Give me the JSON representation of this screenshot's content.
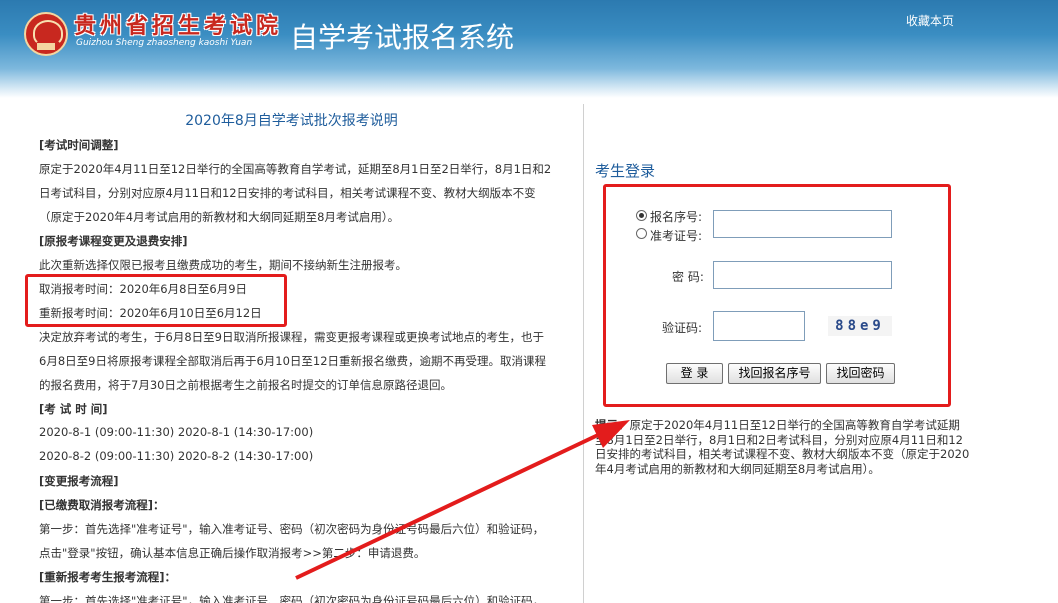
{
  "header": {
    "logo_cn": "贵州省招生考试院",
    "logo_pinyin": "Guizhou Sheng zhaosheng kaoshi Yuan",
    "system_title": "自学考试报名系统",
    "favorite_link": "收藏本页"
  },
  "notice": {
    "title": "2020年8月自学考试批次报考说明",
    "lines": [
      "[考试时间调整]",
      "原定于2020年4月11日至12日举行的全国高等教育自学考试，延期至8月1日至2日举行，8月1日和2",
      "日考试科目，分别对应原4月11日和12日安排的考试科目，相关考试课程不变、教材大纲版本不变",
      "（原定于2020年4月考试启用的新教材和大纲同延期至8月考试启用）。",
      "[原报考课程变更及退费安排]",
      "此次重新选择仅限已报考且缴费成功的考生，期间不接纳新生注册报考。",
      "取消报考时间：2020年6月8日至6月9日",
      "重新报考时间：2020年6月10日至6月12日",
      "决定放弃考试的考生，于6月8日至9日取消所报课程，需变更报考课程或更换考试地点的考生，也于",
      "6月8日至9日将原报考课程全部取消后再于6月10日至12日重新报名缴费，逾期不再受理。取消课程",
      "的报名费用，将于7月30日之前根据考生之前报名时提交的订单信息原路径退回。",
      "[考 试 时 间]",
      "2020-8-1 (09:00-11:30) 2020-8-1 (14:30-17:00)",
      "2020-8-2 (09:00-11:30) 2020-8-2 (14:30-17:00)",
      "[变更报考流程]",
      "[已缴费取消报考流程]：",
      "第一步：首先选择\"准考证号\"，输入准考证号、密码（初次密码为身份证号码最后六位）和验证码，",
      "点击\"登录\"按钮，确认基本信息正确后操作取消报考>>第二步：申请退费。",
      "[重新报考考生报考流程]：",
      "第一步：首先选择\"准考证号\"，输入准考证号、密码（初次密码为身份证号码最后六位）和验证码，"
    ]
  },
  "login": {
    "title": "考生登录",
    "radio_registration": "报名序号:",
    "radio_admission": "准考证号:",
    "password_label": "密  码:",
    "captcha_label": "验证码:",
    "captcha_text": "88e9",
    "login_button": "登  录",
    "find_reg_button": "找回报名序号",
    "find_pwd_button": "找回密码"
  },
  "tip": {
    "label": "提示：",
    "text": "原定于2020年4月11日至12日举行的全国高等教育自学考试延期至8月1日至2日举行，8月1日和2日考试科目，分别对应原4月11日和12日安排的考试科目，相关考试课程不变、教材大纲版本不变（原定于2020年4月考试启用的新教材和大纲同延期至8月考试启用）。"
  },
  "colors": {
    "annotation_red": "#e31c1c",
    "title_blue": "#1f5d9c",
    "brand_red": "#c8281f"
  }
}
